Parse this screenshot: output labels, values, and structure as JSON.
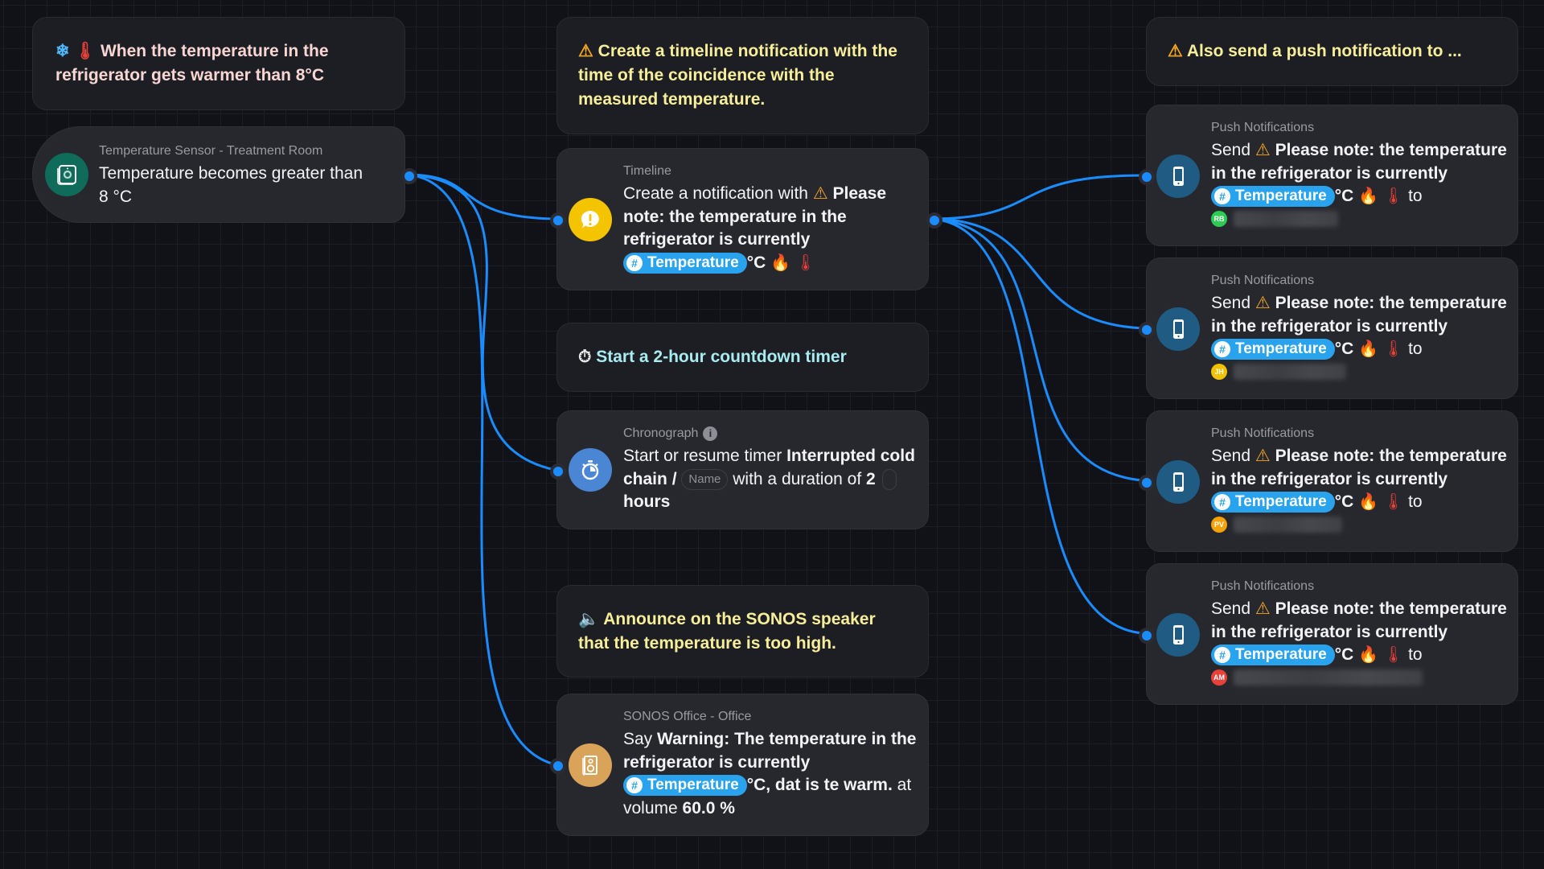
{
  "colors": {
    "wire": "#1a8cff",
    "comment_yellow": "#f6ee9a",
    "comment_pink": "#f8d6d3",
    "comment_cyan": "#a8ecf2",
    "sensor_icon_bg": "#0f6b5a",
    "timeline_icon_bg": "#f5c400",
    "chrono_icon_bg": "#4a86d4",
    "sonos_icon_bg": "#d9a35a",
    "push_icon_bg": "#1f5b82",
    "chip_bg": "#2aa3ee"
  },
  "trigger": {
    "comment": {
      "icons": [
        "snowflake-icon",
        "thermometer-icon"
      ],
      "text": "When the temperature in the refrigerator gets warmer than 8°C"
    },
    "node": {
      "subtitle": "Temperature Sensor - Treatment Room",
      "text": "Temperature becomes greater than",
      "value": "8 °C",
      "icon": "temperature-sensor-icon"
    }
  },
  "timeline": {
    "comment": {
      "icon": "warning-icon",
      "text": "Create a timeline notification with the time of the coincidence with the measured temperature."
    },
    "node": {
      "subtitle": "Timeline",
      "prefix": "Create a notification with",
      "message": "Please note: the temperature in the refrigerator is currently",
      "variable": "Temperature",
      "suffix": "°C",
      "icon": "notification-alert-icon"
    }
  },
  "chronograph": {
    "comment": {
      "icon": "stopwatch-icon",
      "text": "Start a 2-hour countdown timer"
    },
    "node": {
      "subtitle": "Chronograph",
      "prefix": "Start or resume timer",
      "timer_name": "Interrupted cold chain",
      "separator": "/",
      "name_placeholder": "Name",
      "middle": "with a duration of",
      "duration": "2",
      "unit": "hours",
      "icon": "timer-icon"
    }
  },
  "sonos": {
    "comment": {
      "icon": "speaker-icon",
      "text": "Announce on the SONOS speaker that the temperature is too high."
    },
    "node": {
      "subtitle": "SONOS Office - Office",
      "prefix": "Say",
      "message": "Warning: The temperature in the refrigerator is currently",
      "variable": "Temperature",
      "suffix": "°C, dat is te warm.",
      "volume_label": "at volume",
      "volume": "60.0 %",
      "icon": "sonos-speaker-icon"
    }
  },
  "push": {
    "comment": {
      "icon": "warning-icon",
      "text": "Also send a push notification to ..."
    },
    "nodes": [
      {
        "subtitle": "Push Notifications",
        "prefix": "Send",
        "message": "Please note: the temperature in the refrigerator is currently",
        "variable": "Temperature",
        "suffix": "°C",
        "to": "to",
        "recipient_initials": "RB",
        "recipient_color": "#2ecc55"
      },
      {
        "subtitle": "Push Notifications",
        "prefix": "Send",
        "message": "Please note: the temperature in the refrigerator is currently",
        "variable": "Temperature",
        "suffix": "°C",
        "to": "to",
        "recipient_initials": "JH",
        "recipient_color": "#f2c200"
      },
      {
        "subtitle": "Push Notifications",
        "prefix": "Send",
        "message": "Please note: the temperature in the refrigerator is currently",
        "variable": "Temperature",
        "suffix": "°C",
        "to": "to",
        "recipient_initials": "PV",
        "recipient_color": "#f5a10a"
      },
      {
        "subtitle": "Push Notifications",
        "prefix": "Send",
        "message": "Please note: the temperature in the refrigerator is currently",
        "variable": "Temperature",
        "suffix": "°C",
        "to": "to",
        "recipient_initials": "AM",
        "recipient_color": "#e8413a"
      }
    ]
  }
}
